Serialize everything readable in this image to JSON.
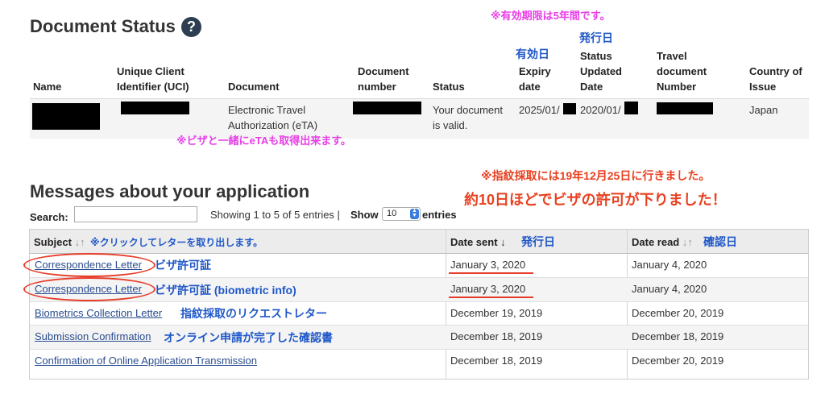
{
  "status_section": {
    "title": "Document Status",
    "help_icon": "question-circle-icon",
    "headers": {
      "name": "Name",
      "uci": [
        "Unique Client",
        "Identifier (UCI)"
      ],
      "document": "Document",
      "document_number": [
        "Document",
        "number"
      ],
      "status": "Status",
      "expiry": [
        "Expiry",
        "date"
      ],
      "updated": [
        "Status",
        "Updated",
        "Date"
      ],
      "travel_doc": [
        "Travel",
        "document",
        "Number"
      ],
      "country": [
        "Country of",
        "Issue"
      ]
    },
    "row": {
      "document": [
        "Electronic Travel",
        "Authorization (eTA)"
      ],
      "status": [
        "Your document",
        "is valid."
      ],
      "expiry": "2025/01/",
      "updated": "2020/01/",
      "country": "Japan"
    }
  },
  "annotations": {
    "validity_note": "※有効期限は5年間です。",
    "expiry_jp": "有効日",
    "updated_jp": "発行日",
    "eta_note": "※ビザと一緒にeTAも取得出来ます。",
    "fingerprint_note": "※指紋採取には19年12月25日に行きました。",
    "visa_note": "約10日ほどでビザの許可が下りました！",
    "subject_note": "※クリックしてレターを取り出します。",
    "date_sent_jp": "発行日",
    "date_read_jp": "確認日"
  },
  "messages_section": {
    "title": "Messages about your application",
    "search_label": "Search:",
    "search_value": "",
    "showing": "Showing 1 to 5 of 5 entries |",
    "show_label": "Show",
    "page_size": "10",
    "entries_label": "entries",
    "columns": {
      "subject": "Subject",
      "subject_sort_icon": "sort-both-icon",
      "date_sent": "Date sent",
      "date_sent_sort_icon": "sort-desc-arrow-icon",
      "date_read": "Date read",
      "date_read_sort_icon": "sort-both-icon"
    },
    "rows": [
      {
        "subject": "Correspondence Letter",
        "note": "ビザ許可証",
        "sent": "January 3, 2020",
        "read": "January 4, 2020"
      },
      {
        "subject": "Correspondence Letter",
        "note": "ビザ許可証 (biometric info)",
        "sent": "January 3, 2020",
        "read": "January 4, 2020"
      },
      {
        "subject": "Biometrics Collection Letter",
        "note": "指紋採取のリクエストレター",
        "sent": "December 19, 2019",
        "read": "December 20, 2019"
      },
      {
        "subject": "Submission Confirmation",
        "note": "オンライン申請が完了した確認書",
        "sent": "December 18, 2019",
        "read": "December 18, 2019"
      },
      {
        "subject": "Confirmation of Online Application Transmission",
        "note": "",
        "sent": "December 18, 2019",
        "read": "December 20, 2019"
      }
    ]
  },
  "colors": {
    "annotation_pink": "#e83ee8",
    "annotation_blue": "#1f57c8",
    "annotation_red": "#e8401f",
    "link": "#2a4d8f"
  }
}
